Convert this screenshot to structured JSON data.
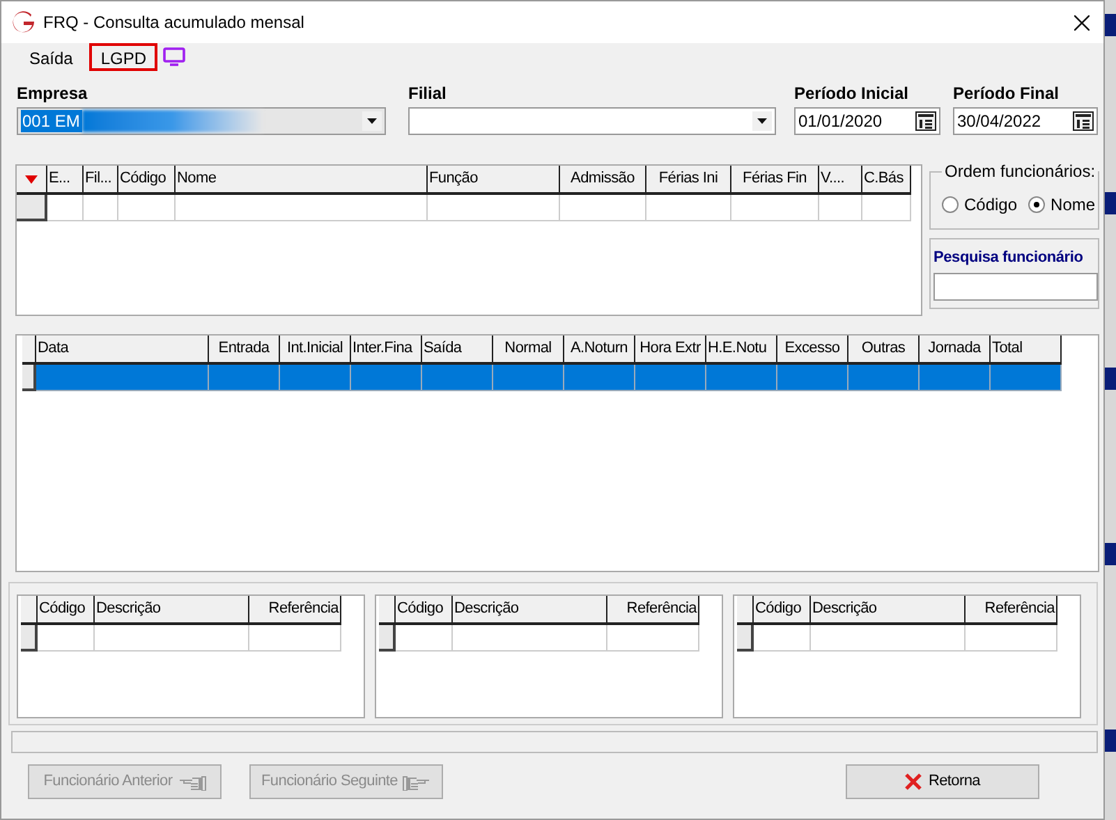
{
  "window": {
    "title": "FRQ - Consulta acumulado mensal"
  },
  "menu": [
    {
      "label": "Saída",
      "highlighted": false
    },
    {
      "label": "LGPD",
      "highlighted": true
    }
  ],
  "filters": {
    "empresa": {
      "label": "Empresa",
      "value": "001 EM"
    },
    "filial": {
      "label": "Filial"
    },
    "periodo_inicial": {
      "label": "Período Inicial",
      "value": "01/01/2020"
    },
    "periodo_final": {
      "label": "Período Final",
      "value": "30/04/2022"
    }
  },
  "employees_grid": {
    "columns": [
      "E...",
      "Fil...",
      "Código",
      "Nome",
      "Função",
      "Admissão",
      "Férias Ini",
      "Férias Fin",
      "V....",
      "C.Bás"
    ]
  },
  "order_group": {
    "title": "Ordem funcionários:",
    "options": [
      {
        "label": "Código",
        "selected": false
      },
      {
        "label": "Nome",
        "selected": true
      }
    ]
  },
  "search": {
    "label": "Pesquisa funcionário"
  },
  "daily_grid": {
    "columns": [
      "Data",
      "Entrada",
      "Int.Inicial",
      "Inter.Fina",
      "Saída",
      "Normal",
      "A.Noturn",
      "Hora Extr",
      "H.E.Notu",
      "Excesso",
      "Outras",
      "Jornada",
      "Total"
    ]
  },
  "sub_grids": [
    {
      "columns": [
        "Código",
        "Descrição",
        "Referência"
      ]
    },
    {
      "columns": [
        "Código",
        "Descrição",
        "Referência"
      ]
    },
    {
      "columns": [
        "Código",
        "Descrição",
        "Referência"
      ]
    }
  ],
  "buttons": [
    {
      "label": "Funcionário Anterior",
      "kind": "prev",
      "disabled": true
    },
    {
      "label": "Funcionário Seguinte",
      "kind": "next",
      "disabled": true
    },
    {
      "label": "Retorna",
      "kind": "close",
      "disabled": false
    }
  ]
}
